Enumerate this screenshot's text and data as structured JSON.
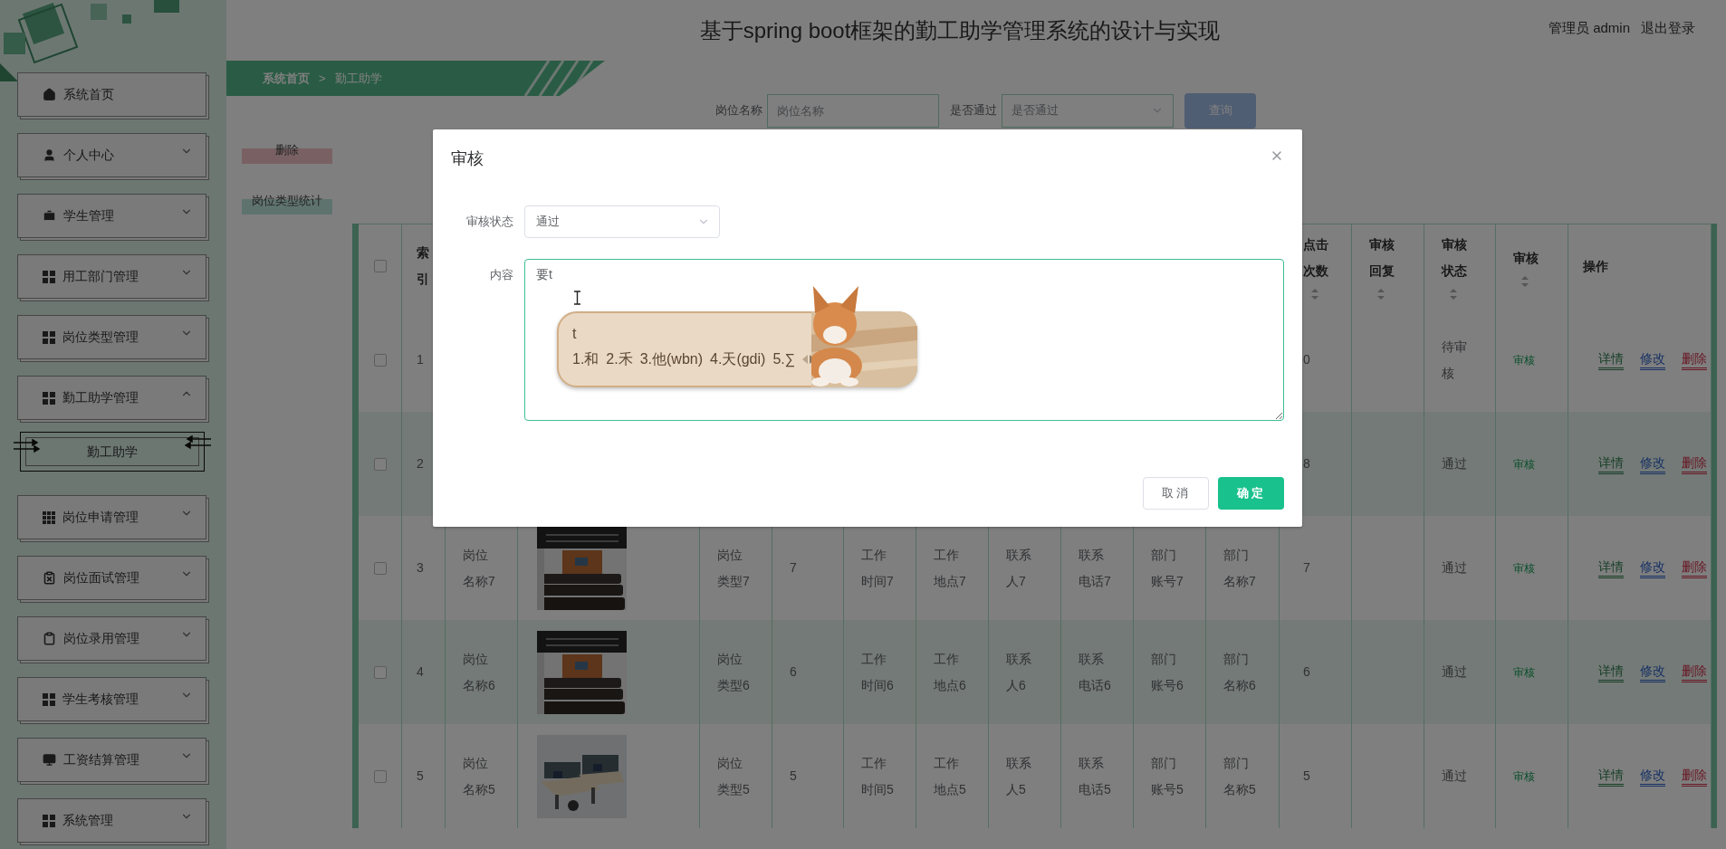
{
  "header": {
    "title": "基于spring boot框架的勤工助学管理系统的设计与实现",
    "user": "管理员 admin",
    "logout": "退出登录"
  },
  "sidebar": {
    "items": [
      {
        "label": "系统首页",
        "kind": "link"
      },
      {
        "label": "个人中心",
        "kind": "menu",
        "expanded": false
      },
      {
        "label": "学生管理",
        "kind": "menu",
        "expanded": false
      },
      {
        "label": "用工部门管理",
        "kind": "menu",
        "expanded": false
      },
      {
        "label": "岗位类型管理",
        "kind": "menu",
        "expanded": false
      },
      {
        "label": "勤工助学管理",
        "kind": "menu",
        "expanded": true,
        "children": [
          {
            "label": "勤工助学",
            "selected": true
          }
        ]
      },
      {
        "label": "岗位申请管理",
        "kind": "menu",
        "expanded": false
      },
      {
        "label": "岗位面试管理",
        "kind": "menu",
        "expanded": false
      },
      {
        "label": "岗位录用管理",
        "kind": "menu",
        "expanded": false
      },
      {
        "label": "学生考核管理",
        "kind": "menu",
        "expanded": false
      },
      {
        "label": "工资结算管理",
        "kind": "menu",
        "expanded": false
      },
      {
        "label": "系统管理",
        "kind": "menu",
        "expanded": false
      }
    ]
  },
  "breadcrumb": [
    "系统首页",
    ">",
    "勤工助学"
  ],
  "search": {
    "fields": [
      {
        "label": "岗位名称",
        "placeholder": "岗位名称",
        "kind": "input"
      },
      {
        "label": "是否通过",
        "placeholder": "是否通过",
        "kind": "select"
      }
    ],
    "button": "查询"
  },
  "actions": [
    {
      "label": "删除",
      "kind": "danger"
    },
    {
      "label": "岗位类型统计",
      "kind": "stat"
    }
  ],
  "table": {
    "all_checked": false,
    "columns": [
      {
        "label": "索引",
        "sortable": false
      },
      {
        "label": "点击次数",
        "sortable": true
      },
      {
        "label": "审核回复",
        "sortable": true
      },
      {
        "label": "审核状态",
        "sortable": true
      },
      {
        "label": "审核",
        "sortable": true
      },
      {
        "label": "操作",
        "sortable": false
      }
    ],
    "rows": [
      {
        "checked": false,
        "index": "1",
        "clicks": "0",
        "status": "待审核",
        "review": "审核",
        "actions": [
          "详情",
          "修改",
          "删除"
        ]
      },
      {
        "checked": false,
        "index": "2",
        "clicks": "8",
        "status": "通过",
        "review": "审核",
        "actions": [
          "详情",
          "修改",
          "删除"
        ]
      },
      {
        "checked": false,
        "index": "3",
        "name": "岗位名称7",
        "type": "岗位类型7",
        "column_6": "7",
        "time": "工作时间7",
        "place": "工作地点7",
        "contact": "联系人7",
        "phone": "联系电话7",
        "account": "部门账号7",
        "dept": "部门名称7",
        "clicks": "7",
        "status": "通过",
        "review": "审核",
        "actions": [
          "详情",
          "修改",
          "删除"
        ]
      },
      {
        "checked": false,
        "index": "4",
        "name": "岗位名称6",
        "type": "岗位类型6",
        "column_6": "6",
        "time": "工作时间6",
        "place": "工作地点6",
        "contact": "联系人6",
        "phone": "联系电话6",
        "account": "部门账号6",
        "dept": "部门名称6",
        "clicks": "6",
        "status": "通过",
        "review": "审核",
        "actions": [
          "详情",
          "修改",
          "删除"
        ]
      },
      {
        "checked": false,
        "index": "5",
        "name": "岗位名称5",
        "type": "岗位类型5",
        "column_6": "5",
        "time": "工作时间5",
        "place": "工作地点5",
        "contact": "联系人5",
        "phone": "联系电话5",
        "account": "部门账号5",
        "dept": "部门名称5",
        "clicks": "5",
        "status": "通过",
        "review": "审核",
        "actions": [
          "详情",
          "修改",
          "删除"
        ]
      }
    ]
  },
  "dialog": {
    "title": "审核",
    "fields": [
      {
        "label": "审核状态",
        "kind": "select",
        "value": "通过"
      },
      {
        "label": "内容",
        "kind": "textarea",
        "value": "要t"
      }
    ],
    "buttons": [
      {
        "label": "取消",
        "kind": "default"
      },
      {
        "label": "确定",
        "kind": "primary"
      }
    ]
  },
  "ime": {
    "composition": "t",
    "candidates": [
      "1.和",
      "2.禾",
      "3.他(wbn)",
      "4.天(gdi)",
      "5.∑"
    ]
  }
}
